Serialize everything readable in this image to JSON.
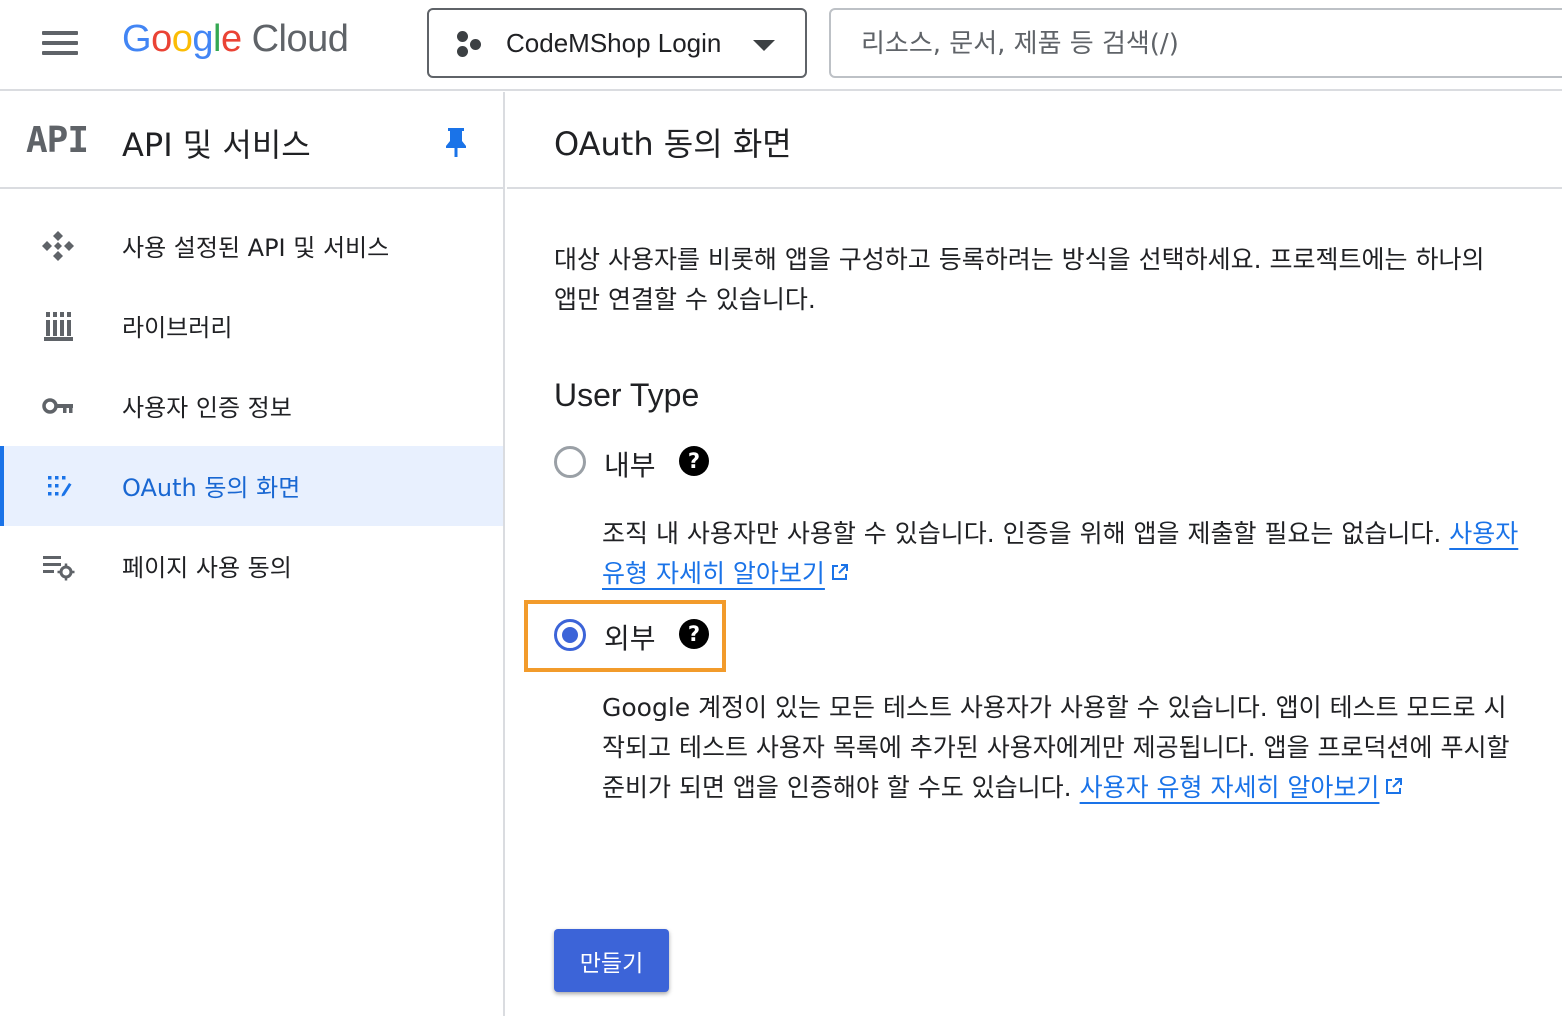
{
  "header": {
    "logo_letters": [
      "G",
      "o",
      "o",
      "g",
      "l",
      "e"
    ],
    "logo_suffix": "Cloud",
    "project_name": "CodeMShop Login",
    "search_placeholder": "리소스, 문서, 제품 등 검색(/)"
  },
  "sidebar": {
    "badge": "API",
    "title": "API 및 서비스",
    "items": [
      {
        "label": "사용 설정된 API 및 서비스",
        "icon": "api-services-icon"
      },
      {
        "label": "라이브러리",
        "icon": "library-icon"
      },
      {
        "label": "사용자 인증 정보",
        "icon": "key-icon"
      },
      {
        "label": "OAuth 동의 화면",
        "icon": "oauth-consent-icon",
        "active": true
      },
      {
        "label": "페이지 사용 동의",
        "icon": "page-usage-settings-icon"
      }
    ]
  },
  "main": {
    "title": "OAuth 동의 화면",
    "intro": "대상 사용자를 비롯해 앱을 구성하고 등록하려는 방식을 선택하세요. 프로젝트에는 하나의 앱만 연결할 수 있습니다.",
    "user_type_title": "User Type",
    "options": [
      {
        "label": "내부",
        "checked": false,
        "description": "조직 내 사용자만 사용할 수 있습니다. 인증을 위해 앱을 제출할 필요는 없습니다.",
        "link": "사용자 유형 자세히 알아보기"
      },
      {
        "label": "외부",
        "checked": true,
        "description": "Google 계정이 있는 모든 테스트 사용자가 사용할 수 있습니다. 앱이 테스트 모드로 시작되고 테스트 사용자 목록에 추가된 사용자에게만 제공됩니다. 앱을 프로덕션에 푸시할 준비가 되면 앱을 인증해야 할 수도 있습니다.",
        "link": "사용자 유형 자세히 알아보기"
      }
    ],
    "help_glyph": "?",
    "create_button": "만들기"
  },
  "colors": {
    "accent": "#1a73e8",
    "radio_selected": "#3c64d8",
    "highlight": "#f29b2b",
    "active_nav_bg": "#e8f0fe"
  }
}
